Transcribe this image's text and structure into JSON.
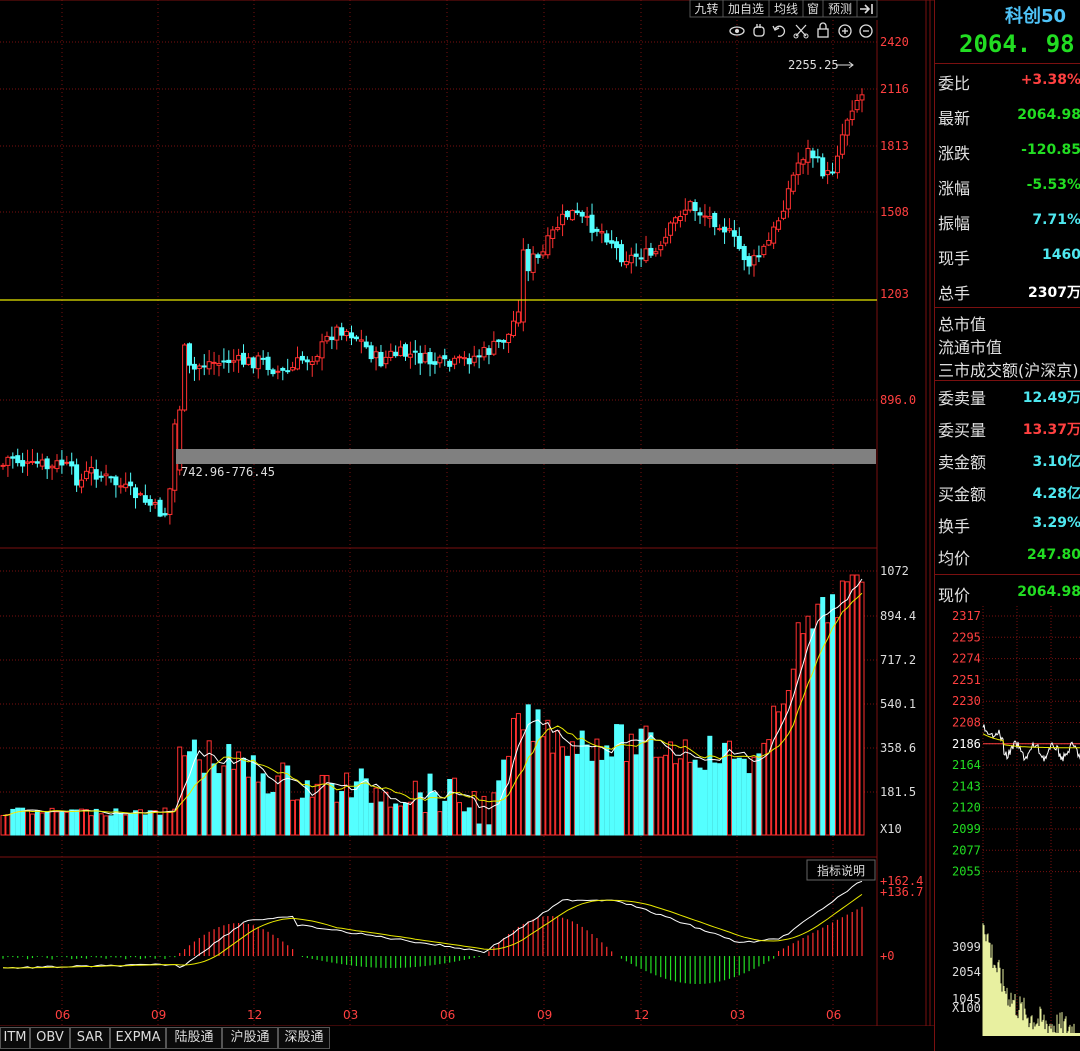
{
  "toolbar": {
    "buttons": [
      "九转",
      "加自选",
      "均线",
      "窗",
      "预测"
    ]
  },
  "price_axis": [
    "2420",
    "2116",
    "1813",
    "1508",
    "1203",
    "896.0"
  ],
  "annotations": {
    "high_label": "2255.25",
    "gap_label": "742.96-776.45"
  },
  "volume_axis": [
    "1072",
    "894.4",
    "717.2",
    "540.1",
    "358.6",
    "181.5",
    "X10"
  ],
  "macd": {
    "button": "指标说明",
    "axis": [
      "+162.4",
      "+136.7",
      "+0"
    ]
  },
  "x_labels": [
    "06",
    "09",
    "12",
    "03",
    "06",
    "09",
    "12",
    "03",
    "06"
  ],
  "bottom_tabs": [
    "ITM",
    "OBV",
    "SAR",
    "EXPMA",
    "陆股通",
    "沪股通",
    "深股通"
  ],
  "panel": {
    "code": "科创50",
    "price": "2064. 98",
    "stats1": [
      {
        "k": "委比",
        "v": "+3.38%",
        "c": "red"
      },
      {
        "k": "最新",
        "v": "2064.98",
        "c": "grn"
      },
      {
        "k": "涨跌",
        "v": "-120.85",
        "c": "grn"
      },
      {
        "k": "涨幅",
        "v": "-5.53%",
        "c": "grn"
      },
      {
        "k": "振幅",
        "v": "7.71%",
        "c": "cyn"
      },
      {
        "k": "现手",
        "v": "1460",
        "c": "cyn"
      },
      {
        "k": "总手",
        "v": "2307万",
        "c": "wht"
      }
    ],
    "stats2": [
      "总市值",
      "流通市值",
      "三市成交额(沪深京)"
    ],
    "stats3": [
      {
        "k": "委卖量",
        "v": "12.49万",
        "c": "cyn"
      },
      {
        "k": "委买量",
        "v": "13.37万",
        "c": "red"
      },
      {
        "k": "卖金额",
        "v": "3.10亿",
        "c": "cyn"
      },
      {
        "k": "买金额",
        "v": "4.28亿",
        "c": "cyn"
      },
      {
        "k": "换手",
        "v": "3.29%",
        "c": "cyn"
      },
      {
        "k": "均价",
        "v": "247.80",
        "c": "grn"
      }
    ],
    "now": {
      "k": "现价",
      "v": "2064.98"
    },
    "mini_price_axis": [
      "2317",
      "2295",
      "2274",
      "2251",
      "2230",
      "2208",
      "2186",
      "2164",
      "2143",
      "2120",
      "2099",
      "2077",
      "2055"
    ],
    "mini_vol_axis": [
      "3099",
      "2054",
      "1045",
      "X100"
    ]
  },
  "colors": {
    "up": "#ff3030",
    "down": "#54ffff",
    "ma1": "#ffffff",
    "ma2": "#e8e800",
    "grid": "#7a1010",
    "hline": "#e8e800"
  }
}
